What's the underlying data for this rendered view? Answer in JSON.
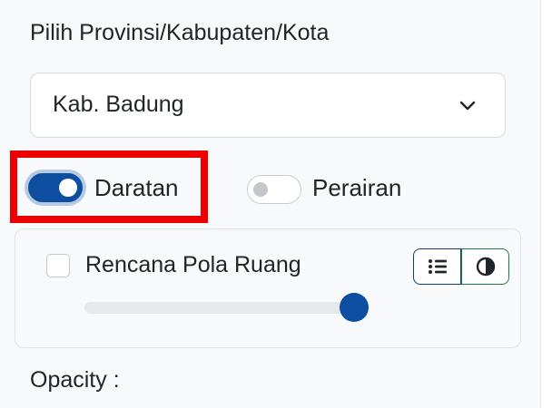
{
  "region": {
    "label": "Pilih Provinsi/Kabupaten/Kota",
    "selected": "Kab. Badung"
  },
  "toggles": {
    "daratan": {
      "label": "Daratan",
      "on": true
    },
    "perairan": {
      "label": "Perairan",
      "on": false
    }
  },
  "layer": {
    "title": "Rencana Pola Ruang",
    "checked": false,
    "slider_value_percent": 100,
    "legend_icon": "list-icon",
    "opacity_icon": "contrast-icon"
  },
  "opacity": {
    "label": "Opacity :"
  },
  "colors": {
    "accent": "#0d4ea0",
    "highlight": "#ee0000",
    "legend_border": "#0d3f7e",
    "opacity_border": "#1e7a4a"
  }
}
